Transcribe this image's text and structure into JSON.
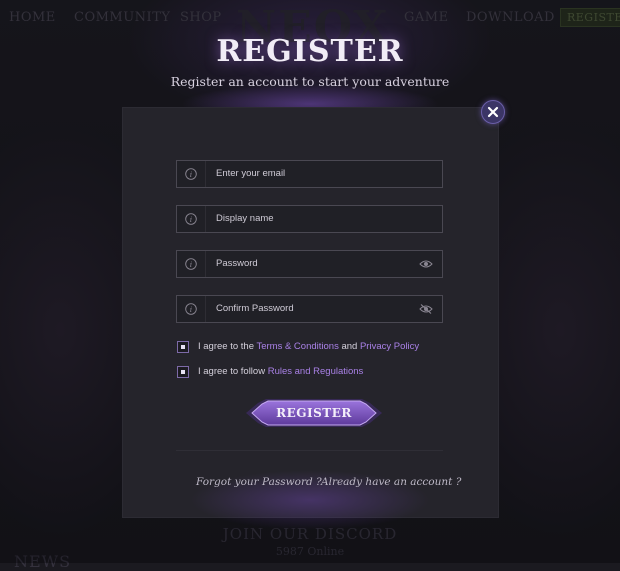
{
  "background": {
    "nav": [
      "HOME",
      "COMMUNITY",
      "SHOP",
      "GAME",
      "DOWNLOAD"
    ],
    "nav_register": "REGISTER",
    "logo": "NEOX",
    "discord_title": "JOIN OUR DISCORD",
    "discord_online": "5987 Online",
    "news": "NEWS"
  },
  "modal": {
    "title": "REGISTER",
    "subtitle": "Register an account to start your adventure",
    "close_icon": "close-icon",
    "fields": [
      {
        "placeholder": "Enter your email",
        "icon": "info-icon",
        "value": ""
      },
      {
        "placeholder": "Display name",
        "icon": "info-icon",
        "value": ""
      },
      {
        "placeholder": "Password",
        "icon": "info-icon",
        "value": "",
        "toggle_icon": "eye-icon"
      },
      {
        "placeholder": "Confirm Password",
        "icon": "info-icon",
        "value": "",
        "toggle_icon": "eye-slash-icon"
      }
    ],
    "agree_terms": {
      "prefix": "I agree to the ",
      "terms_link": "Terms & Conditions",
      "middle": " and ",
      "privacy_link": "Privacy Policy"
    },
    "agree_rules": {
      "prefix": "I agree to follow ",
      "rules_link": "Rules and Regulations"
    },
    "submit_label": "REGISTER",
    "forgot_password": "Forgot your Password ?",
    "have_account": "Already have an account ?"
  },
  "colors": {
    "accent": "#a981e6",
    "panel": "#25242b",
    "button": "#7a55c0"
  }
}
